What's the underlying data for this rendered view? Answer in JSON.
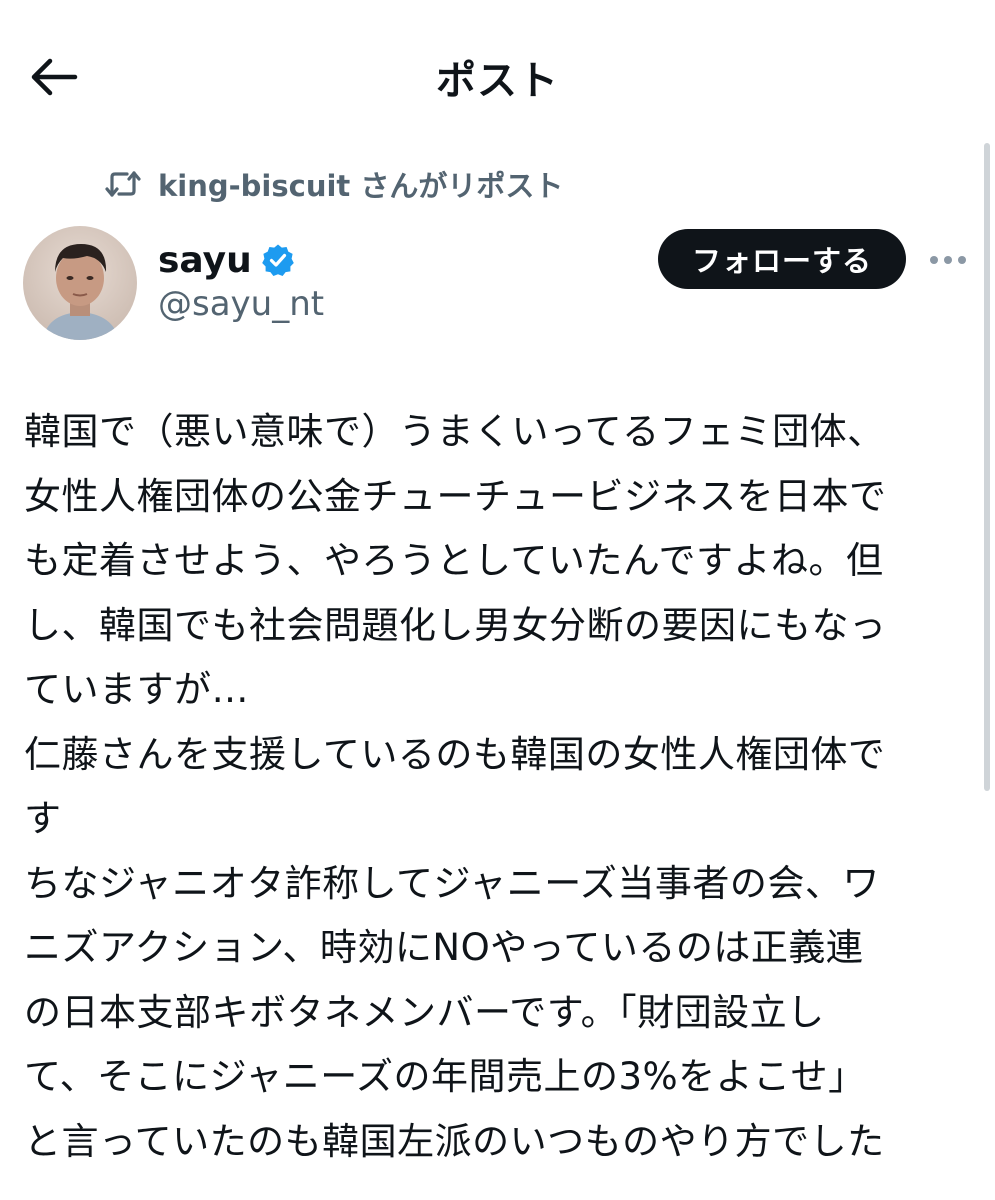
{
  "header": {
    "title": "ポスト"
  },
  "repost": {
    "text": "king-biscuit さんがリポスト"
  },
  "author": {
    "display_name": "sayu",
    "handle": "@sayu_nt",
    "verified": true
  },
  "follow_button": {
    "label": "フォローする"
  },
  "post": {
    "lines": [
      "韓国で（悪い意味で）うまくいってるフェミ団体、",
      "女性人権団体の公金チューチュービジネスを日本で",
      "も定着させよう、やろうとしていたんですよね。但",
      "し、韓国でも社会問題化し男女分断の要因にもなっ",
      "ていますが…",
      "仁藤さんを支援しているのも韓国の女性人権団体で",
      "す",
      "ちなジャニオタ詐称してジャニーズ当事者の会、ワ",
      "ニズアクション、時効にNOやっているのは正義連",
      "の日本支部キボタネメンバーです。「財団設立し",
      "て、そこにジャニーズの年間売上の3%をよこせ」",
      "と言っていたのも韓国左派のいつものやり方でした"
    ]
  },
  "icons": {
    "back": "back-arrow-icon",
    "repost": "repost-icon",
    "verified": "verified-badge-icon",
    "more": "more-options-icon"
  },
  "colors": {
    "text": "#0f1419",
    "secondary": "#536471",
    "verified": "#1d9bf0",
    "follow_bg": "#0f1419"
  }
}
